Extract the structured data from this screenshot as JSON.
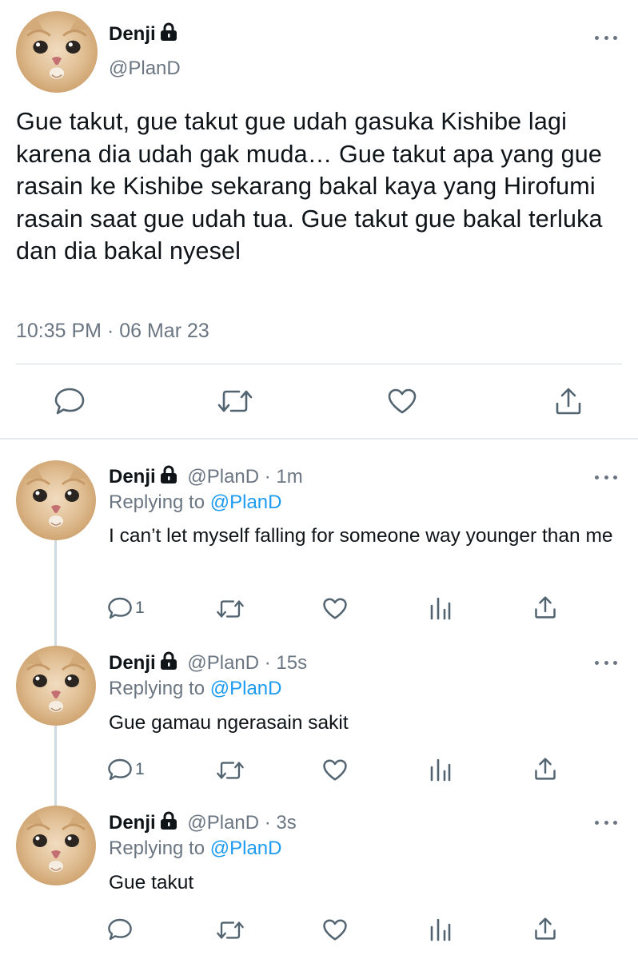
{
  "main_tweet": {
    "display_name": "Denji",
    "handle": "@PlanD",
    "text": "Gue takut, gue takut gue udah gasuka Kishibe lagi karena dia udah gak muda… Gue takut apa yang gue rasain ke Kishibe sekarang bakal kaya yang Hirofumi rasain saat gue udah tua. Gue takut gue bakal terluka dan dia bakal nyesel",
    "timestamp": "10:35 PM · 06 Mar 23",
    "actions": [
      "reply-icon",
      "retweet-icon",
      "like-icon",
      "share-icon"
    ]
  },
  "replies": [
    {
      "display_name": "Denji",
      "handle": "@PlanD",
      "time": "1m",
      "replying_prefix": "Replying to",
      "replying_to": "@PlanD",
      "text": "I can’t let myself falling for someone way younger than me",
      "reply_count": "1"
    },
    {
      "display_name": "Denji",
      "handle": "@PlanD",
      "time": "15s",
      "replying_prefix": "Replying to",
      "replying_to": "@PlanD",
      "text": "Gue gamau ngerasain sakit",
      "reply_count": "1"
    },
    {
      "display_name": "Denji",
      "handle": "@PlanD",
      "time": "3s",
      "replying_prefix": "Replying to",
      "replying_to": "@PlanD",
      "text": "Gue takut",
      "reply_count": ""
    }
  ],
  "colors": {
    "text": "#0f1419",
    "secondary": "#6b7682",
    "mention": "#1d9bf0",
    "divider": "#d6dbdf"
  }
}
